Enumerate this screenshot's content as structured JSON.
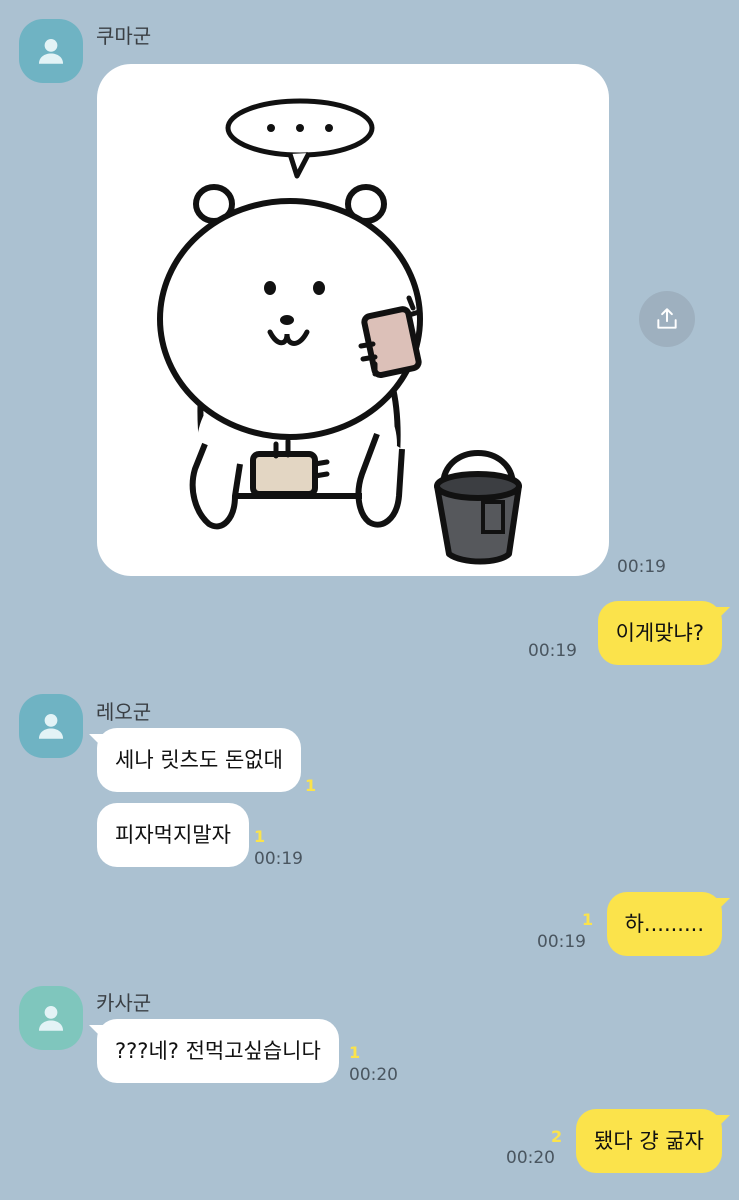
{
  "messages": {
    "m1": {
      "sender": "쿠마군",
      "time": "00:19"
    },
    "m2": {
      "text": "이게맞냐?",
      "time": "00:19"
    },
    "m3": {
      "sender": "레오군",
      "text1": "세나 릿츠도 돈없대",
      "unread1": "1",
      "text2": "피자먹지말자",
      "unread2": "1",
      "time": "00:19"
    },
    "m4": {
      "text": "하.........",
      "unread": "1",
      "time": "00:19"
    },
    "m5": {
      "sender": "카사군",
      "text": "???네? 전먹고싶습니다",
      "unread": "1",
      "time": "00:20"
    },
    "m6": {
      "text": "됐다 걍 굶자",
      "unread": "2",
      "time": "00:20"
    }
  },
  "sticker": {
    "bubble_text": "• • •",
    "description": "bear-cleaning-sticker"
  },
  "colors": {
    "background": "#abc1d1",
    "my_bubble": "#fbe34b",
    "other_bubble": "#ffffff",
    "unread": "#fbe34b"
  },
  "icons": {
    "avatar": "person-icon",
    "share": "share-icon"
  }
}
